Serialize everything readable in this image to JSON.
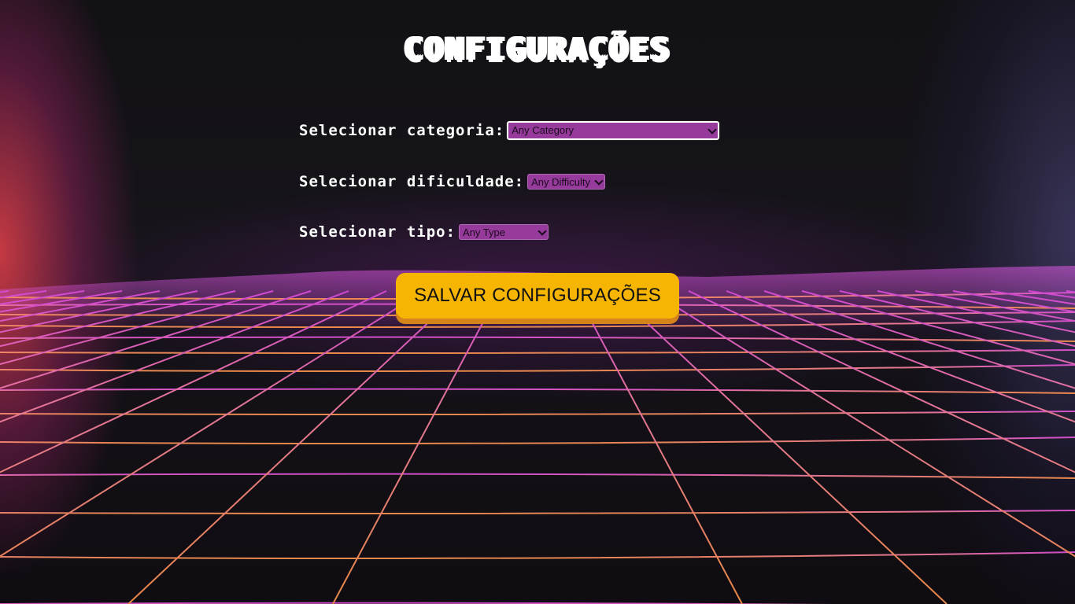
{
  "page": {
    "title": "CONFIGURAÇÕES"
  },
  "form": {
    "category": {
      "label": "Selecionar categoria:",
      "selected": "Any Category"
    },
    "difficulty": {
      "label": "Selecionar dificuldade:",
      "selected": "Any Difficulty"
    },
    "type": {
      "label": "Selecionar tipo:",
      "selected": "Any Type"
    },
    "save_button": "SALVAR CONFIGURAÇÕES"
  },
  "colors": {
    "select_bg": "#963a9c",
    "button_bg": "#f6b503",
    "button_shadow": "#d4841a",
    "grid_line": "#f07a7a",
    "text": "#ffffff"
  }
}
